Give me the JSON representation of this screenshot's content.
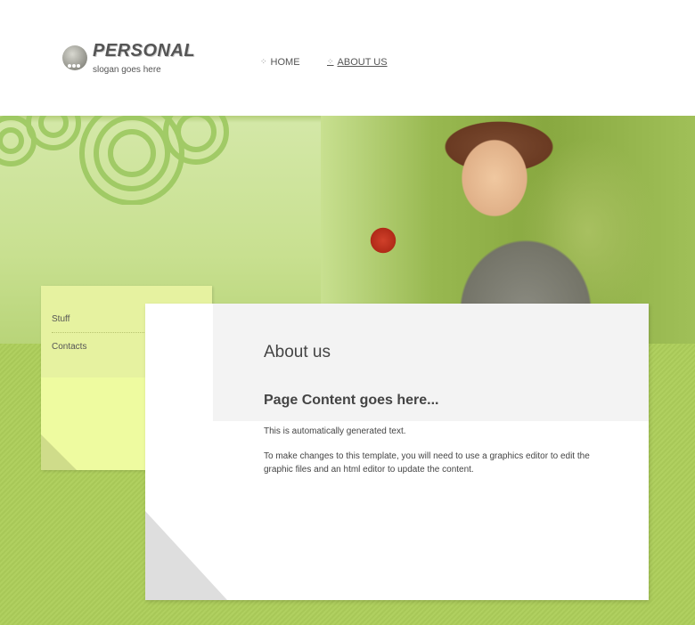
{
  "header": {
    "logo_title": "PERSONAL",
    "slogan": "slogan goes here",
    "nav": [
      {
        "label": "HOME",
        "active": false
      },
      {
        "label": "ABOUT US",
        "active": true
      }
    ]
  },
  "sidebar": {
    "items": [
      {
        "label": "Stuff"
      },
      {
        "label": "Contacts"
      }
    ],
    "item_marker": "”"
  },
  "content": {
    "title": "About us",
    "subtitle": "Page Content goes here...",
    "paragraph1": "This is automatically generated text.",
    "paragraph2": "To make changes to this template, you will need to use a graphics editor to edit the graphic files and an html editor to update the content."
  },
  "colors": {
    "banner_green": "#c8e090",
    "lower_green": "#a8c858",
    "sticky_note": "#e6f2a0",
    "text": "#444444"
  },
  "icons": {
    "nav_arrow": "dotted-arrow-icon",
    "logo": "dots-badge-icon"
  }
}
